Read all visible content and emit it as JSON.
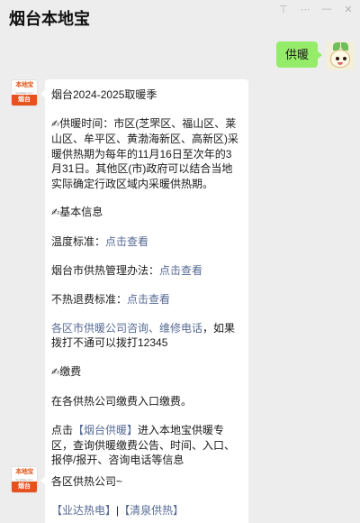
{
  "header": {
    "title": "烟台本地宝",
    "icons": [
      "pin-icon",
      "more-icon",
      "minimize-icon",
      "close-icon"
    ]
  },
  "user_message": {
    "text": "供暖"
  },
  "bot_avatar": {
    "top": "本地宝",
    "mid": "bendibao.com",
    "bottom": "烟台"
  },
  "card1": {
    "title": "烟台2024-2025取暖季",
    "pen_glyph": "✍",
    "heating_time_label": "供暖时间：",
    "heating_time_text": "市区(芝罘区、福山区、莱山区、牟平区、黄渤海新区、高新区)采暖供热期为每年的11月16日至次年的3月31日。其他区(市)政府可以结合当地实际确定行政区域内采暖供热期。",
    "basic_info_label": "基本信息",
    "temp_label": "温度标准：",
    "temp_link": "点击查看",
    "method_label": "烟台市供热管理办法：",
    "method_link": "点击查看",
    "refund_label": "不热退费标准：",
    "refund_link": "点击查看",
    "consult_link": "各区市供暖公司咨询、维修电话",
    "consult_text": "，如果拨打不通可以拨打12345",
    "payment_label": "缴费",
    "payment_text": "在各供热公司缴费入口缴费。",
    "click_prefix": "点击",
    "click_link": "【烟台供暖】",
    "click_text": "进入本地宝供暖专区，查询供暖缴费公告、时间、入口、报停/报开、咨询电话等信息"
  },
  "card2": {
    "title": "各区供热公司~",
    "link1": "【业达热电】",
    "separator": "|",
    "link2": "【清泉供热】"
  },
  "colors": {
    "bubble": "#95ec69",
    "link": "#576b95",
    "background": "#ededed",
    "brand": "#e8501e"
  }
}
